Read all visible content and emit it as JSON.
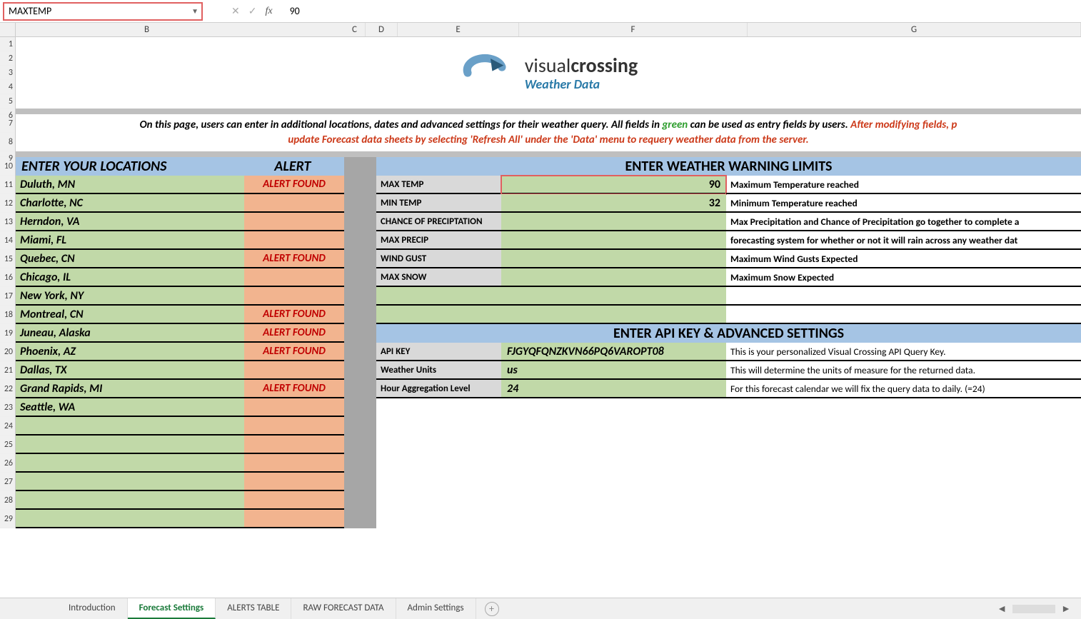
{
  "formula_bar": {
    "name_box": "MAXTEMP",
    "formula": "90"
  },
  "columns": [
    "B",
    "C",
    "D",
    "E",
    "F",
    "G"
  ],
  "rows_visible": [
    "1",
    "2",
    "3",
    "4",
    "5",
    "6",
    "7",
    "8",
    "9",
    "10",
    "11",
    "12",
    "13",
    "14",
    "15",
    "16",
    "17",
    "18",
    "19",
    "20",
    "21",
    "22",
    "23",
    "24",
    "25",
    "26",
    "27",
    "28",
    "29"
  ],
  "logo": {
    "brand_light": "visual",
    "brand_bold": "crossing",
    "subtitle": "Weather Data"
  },
  "info_text": {
    "part1": "On this page, users can enter in additional locations, dates and advanced settings for their weather query.  All fields in ",
    "green": "green",
    "part2": "  can be used as entry fields by users.  ",
    "red1": "After modifying fields, p",
    "red2": "update Forecast data sheets by selecting 'Refresh All' under the 'Data' menu to requery weather data from the server."
  },
  "section_headers": {
    "locations": "ENTER YOUR LOCATIONS",
    "alert": "ALERT",
    "limits": "ENTER WEATHER WARNING LIMITS",
    "api": "ENTER API KEY & ADVANCED SETTINGS"
  },
  "locations": [
    {
      "name": "Duluth, MN",
      "alert": "ALERT FOUND"
    },
    {
      "name": "Charlotte, NC",
      "alert": ""
    },
    {
      "name": "Herndon, VA",
      "alert": ""
    },
    {
      "name": "Miami, FL",
      "alert": ""
    },
    {
      "name": "Quebec, CN",
      "alert": "ALERT FOUND"
    },
    {
      "name": "Chicago, IL",
      "alert": ""
    },
    {
      "name": "New York, NY",
      "alert": ""
    },
    {
      "name": "Montreal, CN",
      "alert": "ALERT FOUND"
    },
    {
      "name": "Juneau, Alaska",
      "alert": "ALERT FOUND"
    },
    {
      "name": "Phoenix, AZ",
      "alert": "ALERT FOUND"
    },
    {
      "name": "Dallas, TX",
      "alert": ""
    },
    {
      "name": "Grand Rapids, MI",
      "alert": "ALERT FOUND"
    },
    {
      "name": "Seattle, WA",
      "alert": ""
    },
    {
      "name": "",
      "alert": ""
    },
    {
      "name": "",
      "alert": ""
    },
    {
      "name": "",
      "alert": ""
    },
    {
      "name": "",
      "alert": ""
    },
    {
      "name": "",
      "alert": ""
    },
    {
      "name": "",
      "alert": ""
    }
  ],
  "limits": [
    {
      "label": "MAX TEMP",
      "value": "90",
      "desc": "Maximum Temperature reached",
      "selected": true
    },
    {
      "label": "MIN TEMP",
      "value": "32",
      "desc": "Minimum Temperature reached"
    },
    {
      "label": "CHANCE OF PRECIPTATION",
      "value": "",
      "desc": "Max Precipitation and Chance of Precipitation go together to complete a"
    },
    {
      "label": "MAX PRECIP",
      "value": "",
      "desc": "forecasting system for whether or not it will rain across any weather dat"
    },
    {
      "label": "WIND GUST",
      "value": "",
      "desc": "Maximum Wind Gusts Expected"
    },
    {
      "label": "MAX SNOW",
      "value": "",
      "desc": "Maximum Snow Expected"
    },
    {
      "label": "",
      "value": "",
      "desc": ""
    },
    {
      "label": "",
      "value": "",
      "desc": ""
    }
  ],
  "api_settings": [
    {
      "label": "API KEY",
      "value": "FJGYQFQNZKVN66PQ6VAROPT08",
      "desc": "This is your personalized Visual Crossing API Query Key."
    },
    {
      "label": "Weather Units",
      "value": "us",
      "desc": "This will determine the units of measure for the returned data."
    },
    {
      "label": "Hour Aggregation Level",
      "value": "24",
      "desc": "For this forecast calendar we will fix the query data to daily. (=24)"
    }
  ],
  "tabs": [
    "Introduction",
    "Forecast Settings",
    "ALERTS TABLE",
    "RAW FORECAST DATA",
    "Admin Settings"
  ],
  "active_tab": "Forecast Settings"
}
